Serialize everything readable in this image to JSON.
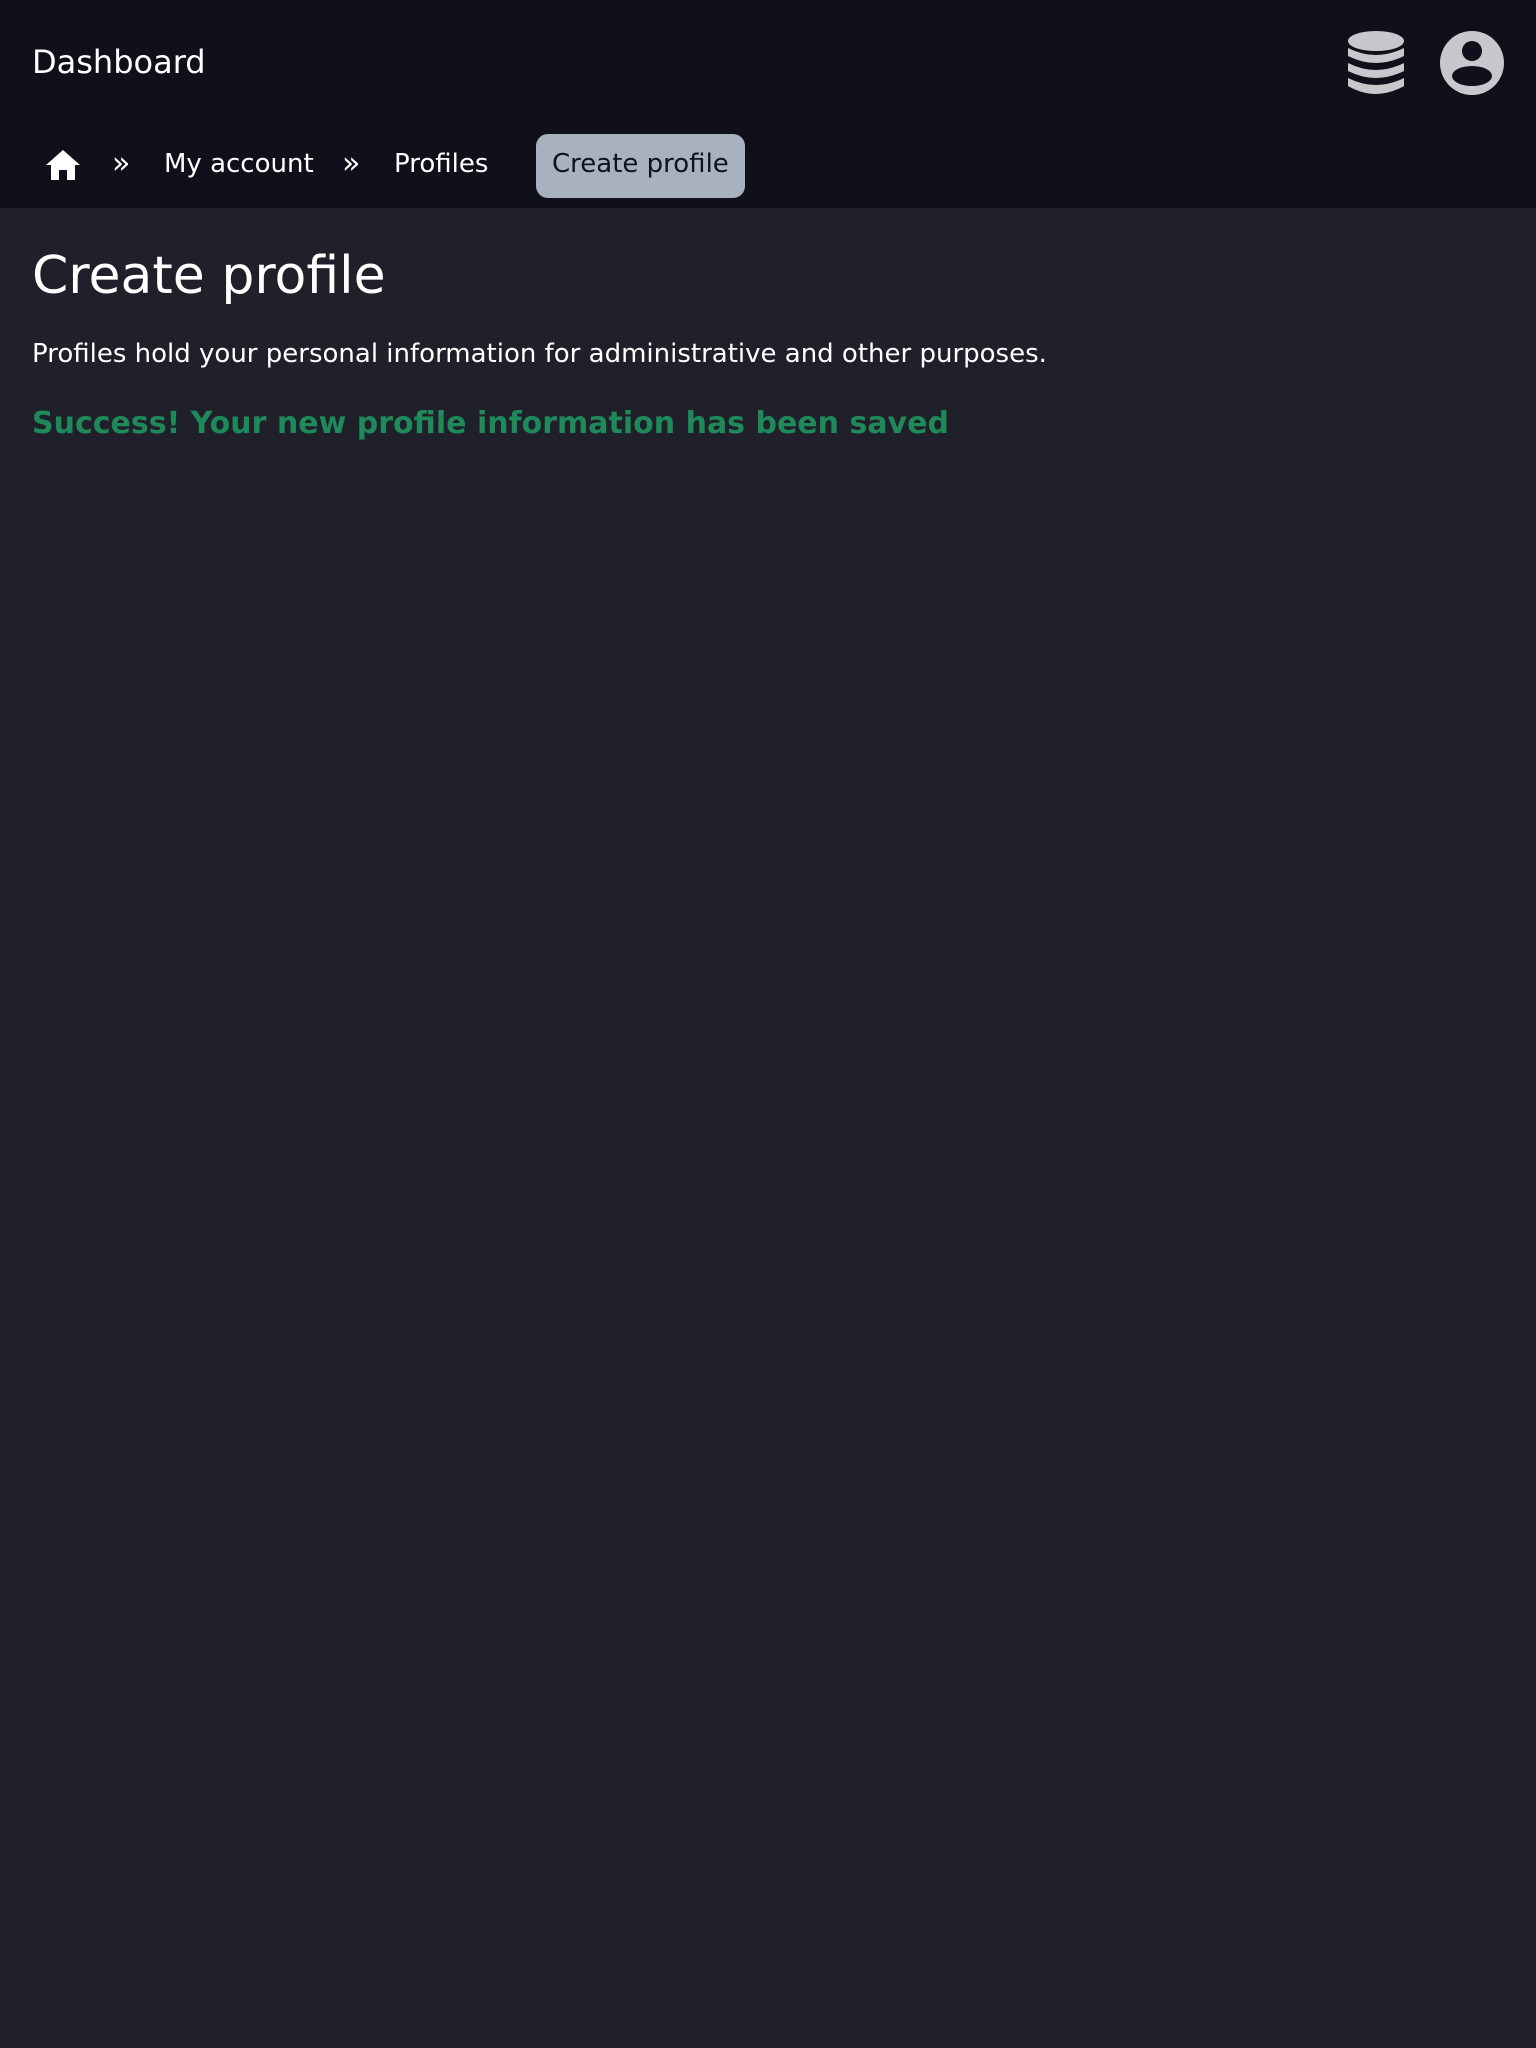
{
  "header": {
    "brand": "Dashboard",
    "database_icon": "database-icon",
    "account_icon": "user-circle-icon"
  },
  "breadcrumb": {
    "home_icon": "home-icon",
    "separator": "»",
    "items": [
      {
        "label": "My account"
      },
      {
        "label": "Profiles"
      }
    ],
    "current": "Create profile"
  },
  "main": {
    "title": "Create profile",
    "description": "Profiles hold your personal information for administrative and other purposes.",
    "success_message": "Success! Your new profile information has been saved"
  },
  "colors": {
    "page_background": "#20202a",
    "header_background": "#10101a",
    "current_crumb_background": "#a8b2be",
    "success": "#1e8a5a",
    "icon": "#c8c8cc"
  }
}
